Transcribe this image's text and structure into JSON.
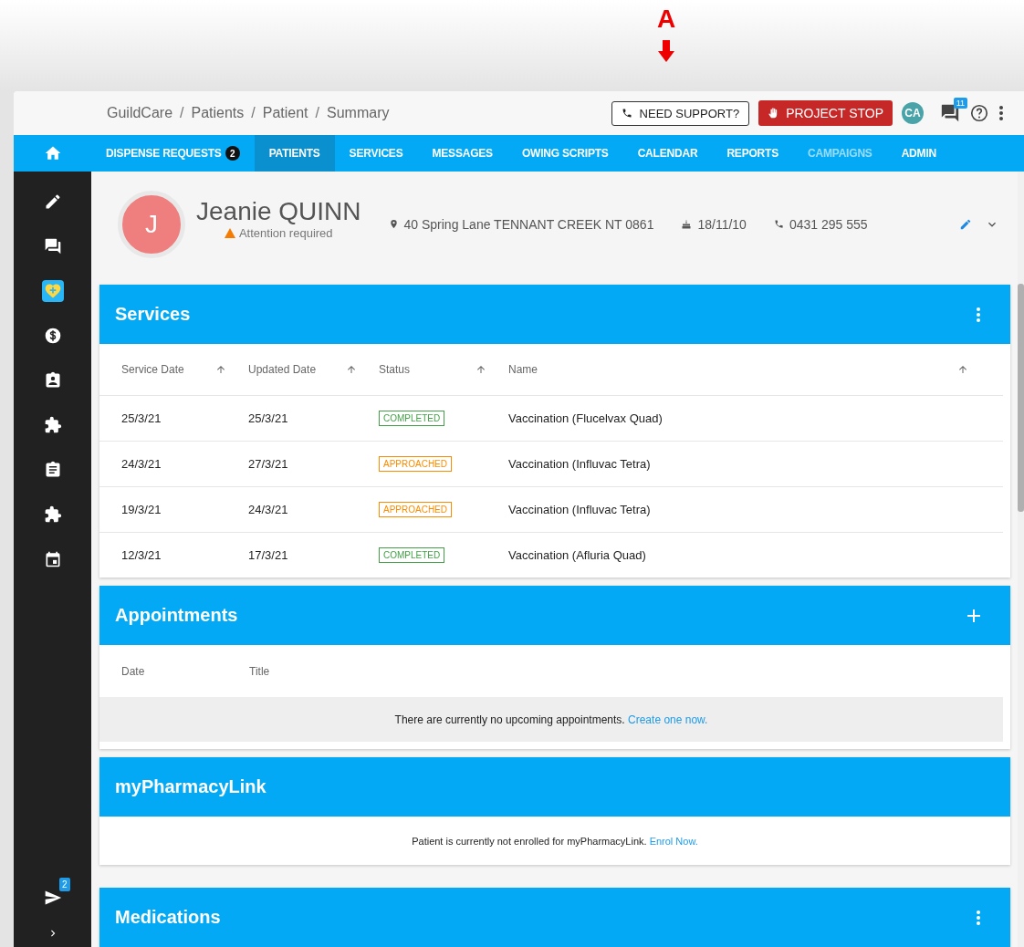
{
  "annotation": {
    "label": "A"
  },
  "breadcrumbs": [
    "GuildCare",
    "Patients",
    "Patient",
    "Summary"
  ],
  "breadcrumb_separator": "/",
  "header": {
    "support_button": "NEED SUPPORT?",
    "stop_button": "PROJECT STOP",
    "avatar": "CA",
    "messages_badge": "11"
  },
  "nav_tabs": [
    {
      "label": "DISPENSE REQUESTS",
      "badge": "2",
      "selected": false,
      "disabled": false
    },
    {
      "label": "PATIENTS",
      "selected": true,
      "disabled": false
    },
    {
      "label": "SERVICES",
      "selected": false,
      "disabled": false
    },
    {
      "label": "MESSAGES",
      "selected": false,
      "disabled": false
    },
    {
      "label": "OWING SCRIPTS",
      "selected": false,
      "disabled": false
    },
    {
      "label": "CALENDAR",
      "selected": false,
      "disabled": false
    },
    {
      "label": "REPORTS",
      "selected": false,
      "disabled": false
    },
    {
      "label": "CAMPAIGNS",
      "selected": false,
      "disabled": true
    },
    {
      "label": "ADMIN",
      "selected": false,
      "disabled": false
    }
  ],
  "sidebar": {
    "items": [
      {
        "selected": false
      },
      {
        "selected": false
      },
      {
        "selected": true
      },
      {
        "selected": false
      },
      {
        "selected": false
      },
      {
        "selected": false
      },
      {
        "selected": false
      },
      {
        "selected": false
      },
      {
        "selected": false
      }
    ],
    "outbox_badge": "2"
  },
  "patient": {
    "initial": "J",
    "name": "Jeanie QUINN",
    "alert": "Attention required",
    "address": "40 Spring Lane TENNANT CREEK NT 0861",
    "dob": "18/11/10",
    "phone": "0431 295 555"
  },
  "services": {
    "title": "Services",
    "columns": [
      "Service Date",
      "Updated Date",
      "Status",
      "Name"
    ],
    "rows": [
      {
        "service_date": "25/3/21",
        "updated_date": "25/3/21",
        "status": {
          "label": "COMPLETED",
          "kind": "completed"
        },
        "name": "Vaccination (Flucelvax Quad)"
      },
      {
        "service_date": "24/3/21",
        "updated_date": "27/3/21",
        "status": {
          "label": "APPROACHED",
          "kind": "approached"
        },
        "name": "Vaccination (Influvac Tetra)"
      },
      {
        "service_date": "19/3/21",
        "updated_date": "24/3/21",
        "status": {
          "label": "APPROACHED",
          "kind": "approached"
        },
        "name": "Vaccination (Influvac Tetra)"
      },
      {
        "service_date": "12/3/21",
        "updated_date": "17/3/21",
        "status": {
          "label": "COMPLETED",
          "kind": "completed"
        },
        "name": "Vaccination (Afluria Quad)"
      }
    ]
  },
  "appointments": {
    "title": "Appointments",
    "columns": [
      "Date",
      "Title"
    ],
    "empty_message": "There are currently no upcoming appointments.",
    "link": "Create one now."
  },
  "pharmacy_link": {
    "title": "myPharmacyLink",
    "message": "Patient is currently not enrolled for myPharmacyLink.",
    "link": "Enrol Now."
  },
  "medications": {
    "title": "Medications"
  }
}
